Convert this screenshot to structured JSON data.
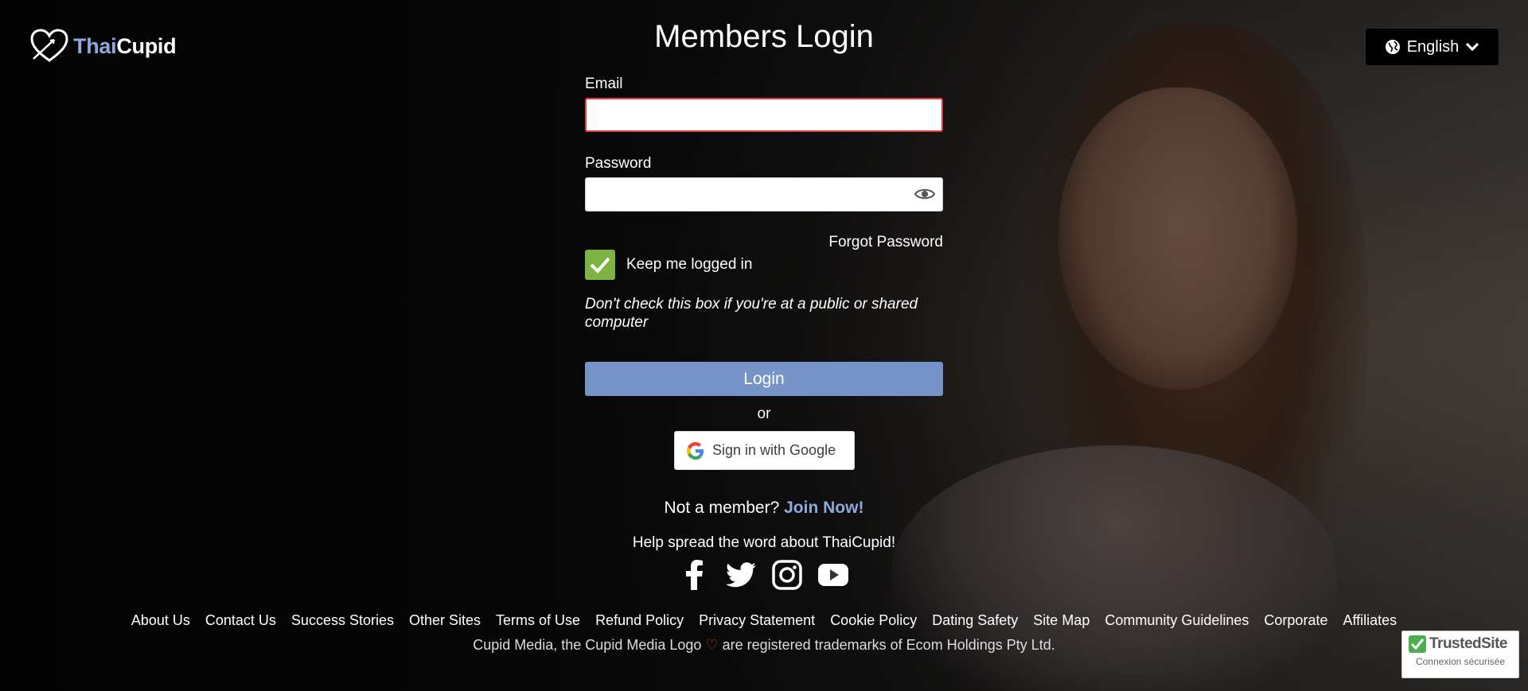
{
  "brand": {
    "name_part1": "Thai",
    "name_part2": "Cupid"
  },
  "language": {
    "label": "English",
    "icon": "globe-icon"
  },
  "page_title": "Members Login",
  "login_form": {
    "email_label": "Email",
    "email_value": "",
    "password_label": "Password",
    "password_value": "",
    "forgot_password": "Forgot Password",
    "keep_logged_in": "Keep me logged in",
    "keep_logged_in_checked": true,
    "warning": "Don't check this box if you're at a public or shared computer",
    "login_button": "Login",
    "or_text": "or",
    "google_button": "Sign in with Google"
  },
  "signup": {
    "prompt": "Not a member?",
    "join_link": "Join Now!"
  },
  "social": {
    "spread_text": "Help spread the word about ThaiCupid!",
    "icons": [
      "facebook-icon",
      "twitter-icon",
      "instagram-icon",
      "youtube-icon"
    ]
  },
  "footer": {
    "links": [
      "About Us",
      "Contact Us",
      "Success Stories",
      "Other Sites",
      "Terms of Use",
      "Refund Policy",
      "Privacy Statement",
      "Cookie Policy",
      "Dating Safety",
      "Site Map",
      "Community Guidelines",
      "Corporate",
      "Affiliates"
    ],
    "trademark_pre": "Cupid Media, the Cupid Media Logo",
    "trademark_post": "are registered trademarks of Ecom Holdings Pty Ltd."
  },
  "trusted_site": {
    "title": "TrustedSite",
    "subtitle": "Connexion sécurisée"
  },
  "colors": {
    "accent_blue": "#7694c7",
    "brand_blue": "#8fa8e0",
    "checkbox_green": "#7cb342",
    "error_red": "#e53935"
  }
}
